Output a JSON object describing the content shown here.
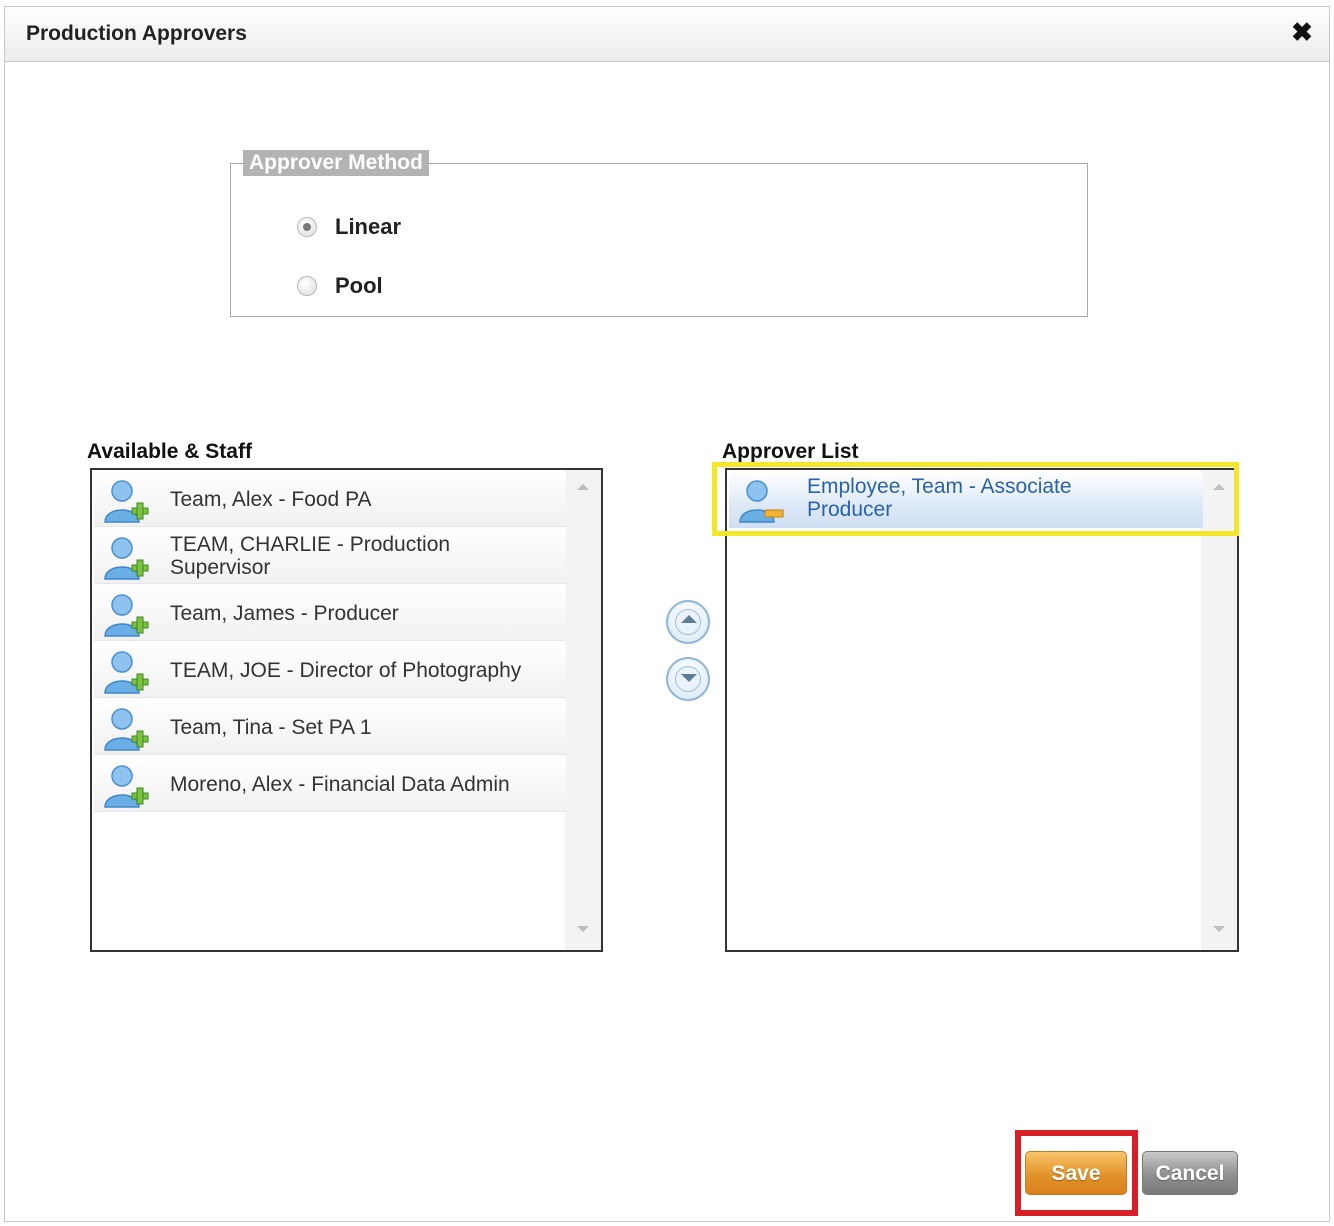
{
  "dialog": {
    "title": "Production Approvers",
    "close_icon": "close-icon"
  },
  "approver_method": {
    "legend": "Approver Method",
    "options": [
      {
        "label": "Linear",
        "checked": true
      },
      {
        "label": "Pool",
        "checked": false
      }
    ]
  },
  "available": {
    "label": "Available & Staff",
    "items": [
      {
        "text": "Team, Alex - Food PA",
        "icon": "add-user-icon"
      },
      {
        "text": "TEAM, CHARLIE - Production Supervisor",
        "icon": "add-user-icon"
      },
      {
        "text": "Team, James - Producer",
        "icon": "add-user-icon"
      },
      {
        "text": "TEAM, JOE - Director of Photography",
        "icon": "add-user-icon"
      },
      {
        "text": "Team, Tina - Set PA 1",
        "icon": "add-user-icon"
      },
      {
        "text": "Moreno, Alex - Financial Data Admin",
        "icon": "add-user-icon"
      }
    ]
  },
  "approvers": {
    "label": "Approver List",
    "items": [
      {
        "text": "Employee, Team - Associate Producer",
        "icon": "remove-user-icon",
        "selected": true
      }
    ]
  },
  "move_buttons": {
    "up_icon": "move-up-icon",
    "down_icon": "move-down-icon"
  },
  "actions": {
    "save": "Save",
    "cancel": "Cancel"
  },
  "colors": {
    "highlight_yellow": "#f4e62a",
    "highlight_red": "#d61f26",
    "save_orange": "#e3932a",
    "selected_text": "#2b62a8"
  }
}
